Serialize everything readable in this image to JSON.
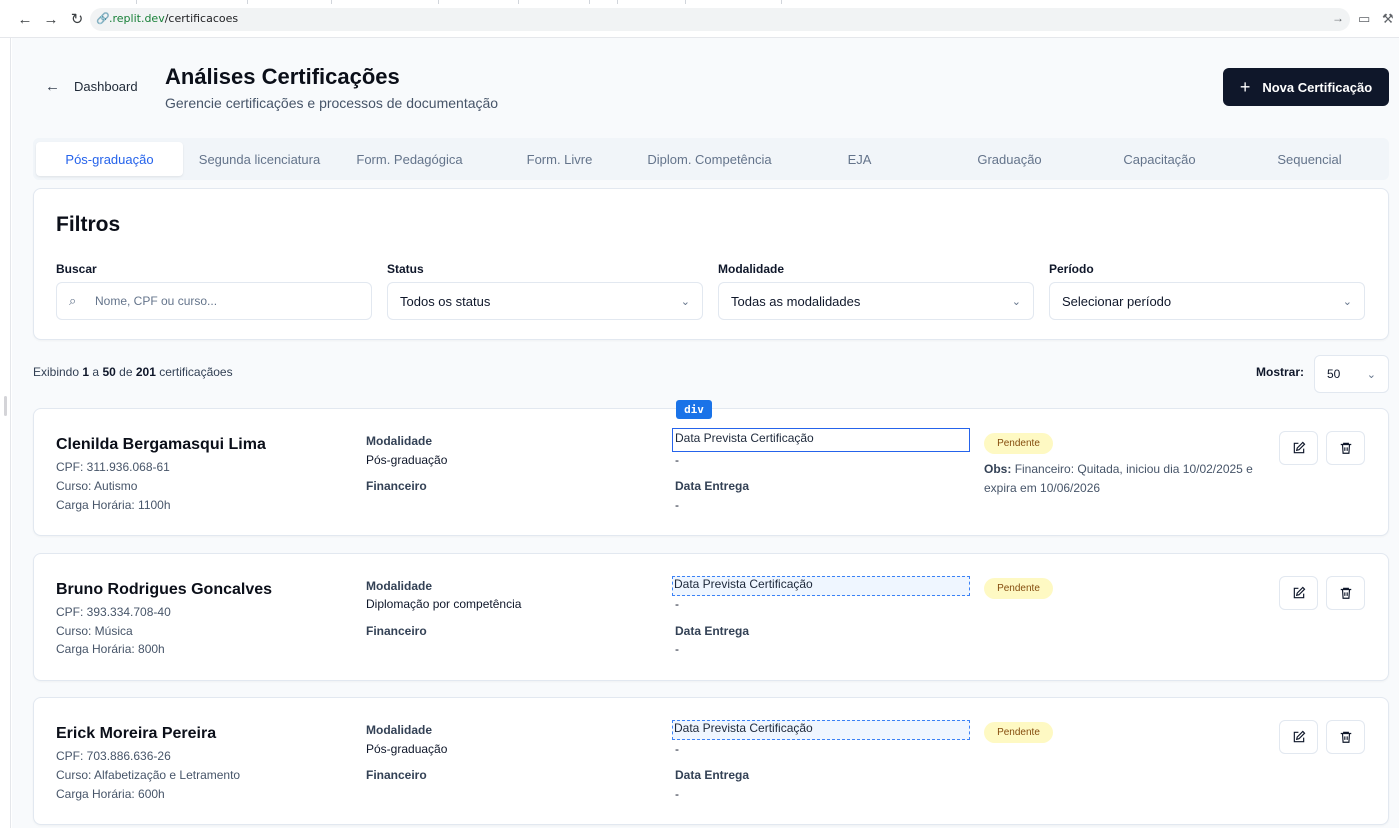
{
  "browser": {
    "url_host": ".replit.dev",
    "url_path": "/certificacoes"
  },
  "header": {
    "back_label": "Dashboard",
    "title": "Análises Certificações",
    "subtitle": "Gerencie certificações e processos de documentação",
    "new_button": "Nova Certificação"
  },
  "tabs": [
    {
      "label": "Pós-graduação",
      "active": true
    },
    {
      "label": "Segunda licenciatura"
    },
    {
      "label": "Form. Pedagógica"
    },
    {
      "label": "Form. Livre"
    },
    {
      "label": "Diplom. Competência"
    },
    {
      "label": "EJA"
    },
    {
      "label": "Graduação"
    },
    {
      "label": "Capacitação"
    },
    {
      "label": "Sequencial"
    }
  ],
  "filters": {
    "title": "Filtros",
    "search_label": "Buscar",
    "search_placeholder": "Nome, CPF ou curso...",
    "status_label": "Status",
    "status_value": "Todos os status",
    "modalidade_label": "Modalidade",
    "modalidade_value": "Todas as modalidades",
    "periodo_label": "Período",
    "periodo_value": "Selecionar período"
  },
  "summary": {
    "prefix": "Exibindo",
    "from": "1",
    "a": "a",
    "to": "50",
    "de": "de",
    "total": "201",
    "suffix": "certificaçãoes",
    "show_label": "Mostrar:",
    "show_value": "50"
  },
  "inspector_tag": "div",
  "records": [
    {
      "name": "Clenilda Bergamasqui Lima",
      "cpf": "CPF: 311.936.068-61",
      "curso": "Curso: Autismo",
      "carga": "Carga Horária: 1100h",
      "modalidade_label": "Modalidade",
      "modalidade": "Pós-graduação",
      "financeiro_label": "Financeiro",
      "data_prevista_label": "Data Prevista Certificação",
      "data_prevista": "-",
      "data_entrega_label": "Data Entrega",
      "data_entrega": "-",
      "status": "Pendente",
      "obs_label": "Obs:",
      "obs": "Financeiro: Quitada, iniciou dia 10/02/2025 e expira em 10/06/2026"
    },
    {
      "name": "Bruno Rodrigues Goncalves",
      "cpf": "CPF: 393.334.708-40",
      "curso": "Curso: Música",
      "carga": "Carga Horária: 800h",
      "modalidade_label": "Modalidade",
      "modalidade": "Diplomação por competência",
      "financeiro_label": "Financeiro",
      "data_prevista_label": "Data Prevista Certificação",
      "data_prevista": "-",
      "data_entrega_label": "Data Entrega",
      "data_entrega": "-",
      "status": "Pendente"
    },
    {
      "name": "Erick Moreira Pereira",
      "cpf": "CPF: 703.886.636-26",
      "curso": "Curso: Alfabetização e Letramento",
      "carga": "Carga Horária: 600h",
      "modalidade_label": "Modalidade",
      "modalidade": "Pós-graduação",
      "financeiro_label": "Financeiro",
      "data_prevista_label": "Data Prevista Certificação",
      "data_prevista": "-",
      "data_entrega_label": "Data Entrega",
      "data_entrega": "-",
      "status": "Pendente"
    }
  ],
  "colors": {
    "primary": "#0f172a",
    "active_tab": "#2563eb",
    "badge_bg": "#fef9c3",
    "badge_text": "#854d0e"
  }
}
